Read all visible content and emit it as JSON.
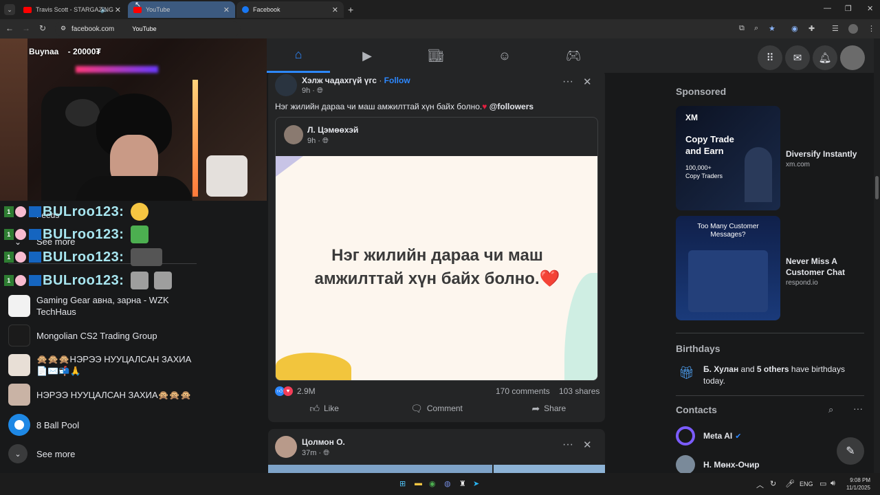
{
  "browser": {
    "tabs": [
      {
        "title": "Travis Scott - STARGAZING"
      },
      {
        "title": "YouTube"
      },
      {
        "title": "Facebook"
      }
    ],
    "url": "facebook.com",
    "url_chip": "YouTube"
  },
  "stream": {
    "overlay": "Buynaa    - 20000₮",
    "chat": [
      {
        "user": "BULroo123:"
      },
      {
        "user": "BULroo123:"
      },
      {
        "user": "BULroo123:"
      },
      {
        "user": "BULroo123:"
      }
    ]
  },
  "left_nav": {
    "partial_feeds": "Feeds",
    "see_more_1": "See more",
    "shortcuts": [
      {
        "label": "Gaming Gear авна, зарна - WZK TechHaus"
      },
      {
        "label": "Mongolian CS2 Trading Group"
      },
      {
        "label": "🙊🙊🙊НЭРЭЭ НУУЦАЛСАН ЗАХИА📄✉️📬🙏"
      },
      {
        "label": "НЭРЭЭ НУУЦАЛСАН ЗАХИА🙊🙊🙊"
      },
      {
        "label": "8 Ball Pool"
      }
    ],
    "see_more_2": "See more"
  },
  "feed": {
    "post1": {
      "author": "Хэлж чадахгүй үгс",
      "follow": "Follow",
      "time": "9h",
      "text": "Нэг жилийн дараа чи маш амжилттай хүн байх болно.",
      "mention": "@followers",
      "shared_author": "Л. Цэмөөхэй",
      "shared_time": "9h",
      "quote": "Нэг жилийн дараа чи маш амжилттай хүн байх болно.❤️",
      "reactions": "2.9M",
      "comments": "170 comments",
      "shares": "103 shares",
      "like": "Like",
      "comment": "Comment",
      "share": "Share"
    },
    "post2": {
      "author": "Цолмон О.",
      "time": "37m"
    }
  },
  "right": {
    "sponsored": "Sponsored",
    "ads": [
      {
        "title": "Diversify Instantly",
        "url": "xm.com",
        "img_line1": "Copy Trade",
        "img_line2": "and Earn",
        "img_sub": "100,000+",
        "img_sub2": "Copy Traders",
        "img_brand": "XM"
      },
      {
        "title": "Never Miss A Customer Chat",
        "url": "respond.io",
        "img_line1": "Too Many Customer",
        "img_line2": "Messages?"
      }
    ],
    "birthdays_heading": "Birthdays",
    "birthday_name": "Б. Хулан",
    "birthday_mid": " and ",
    "birthday_others": "5 others",
    "birthday_end": " have birthdays today.",
    "contacts_heading": "Contacts",
    "contacts": [
      {
        "name": "Meta AI"
      },
      {
        "name": "Н. Мөнх-Очир"
      }
    ]
  },
  "taskbar": {
    "lang": "ENG",
    "time": "9:08 PM",
    "date": "11/1/2025"
  }
}
